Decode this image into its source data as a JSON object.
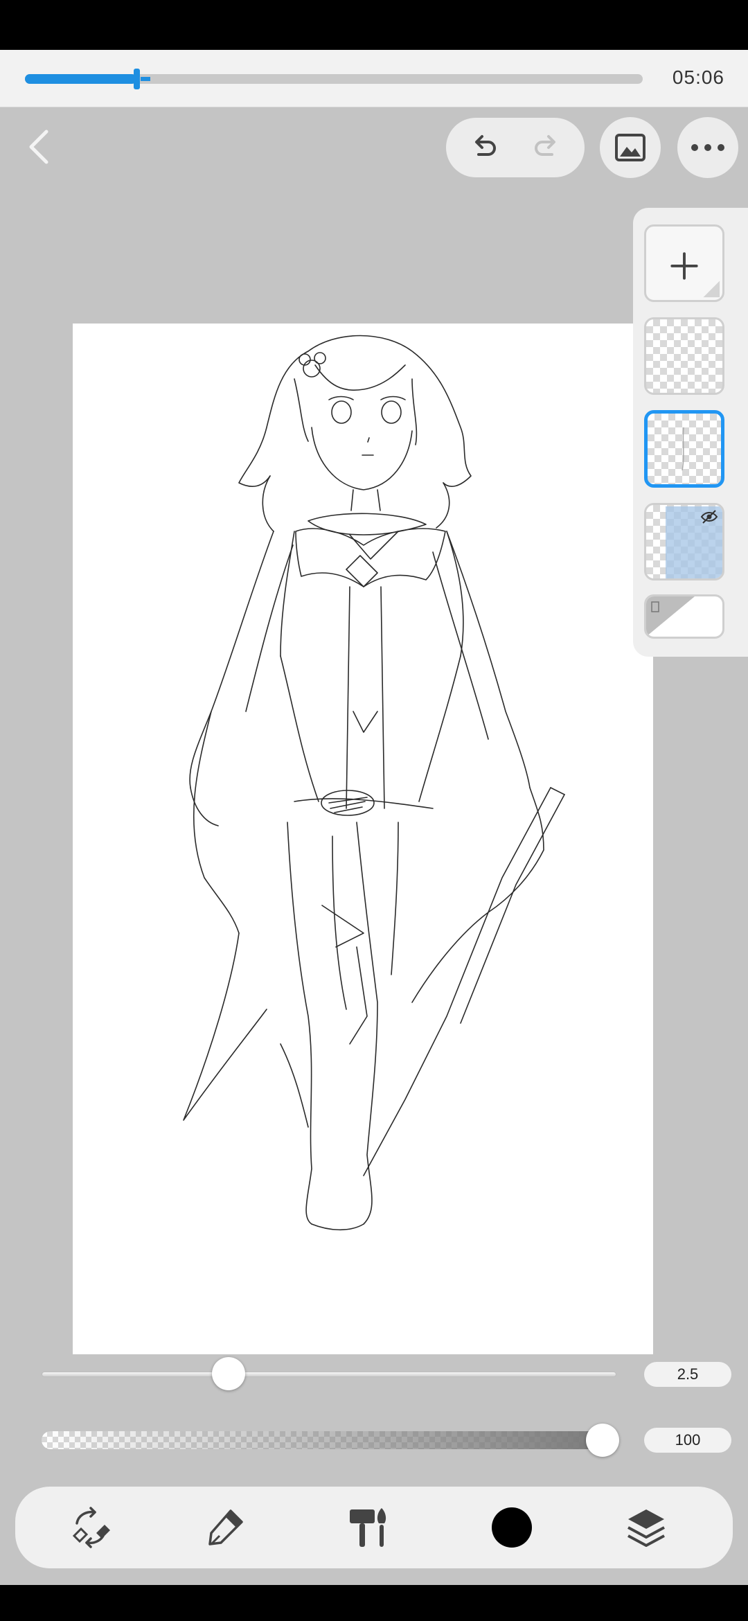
{
  "timeline": {
    "progress": 0.18,
    "time": "05:06"
  },
  "brush": {
    "size": "2.5",
    "size_level": 0.325,
    "opacity": "100",
    "opacity_level": 1.0
  },
  "toolbar": {
    "color": "#000000"
  },
  "colors": {
    "accent": "#2196f3",
    "background": "#c4c4c4"
  },
  "icons": [
    "back-icon",
    "undo-icon",
    "redo-icon",
    "gallery-icon",
    "more-icon",
    "add-layer-icon",
    "hidden-eye-icon",
    "transform-swap-icon",
    "pen-icon",
    "brush-tools-icon",
    "layers-icon"
  ]
}
